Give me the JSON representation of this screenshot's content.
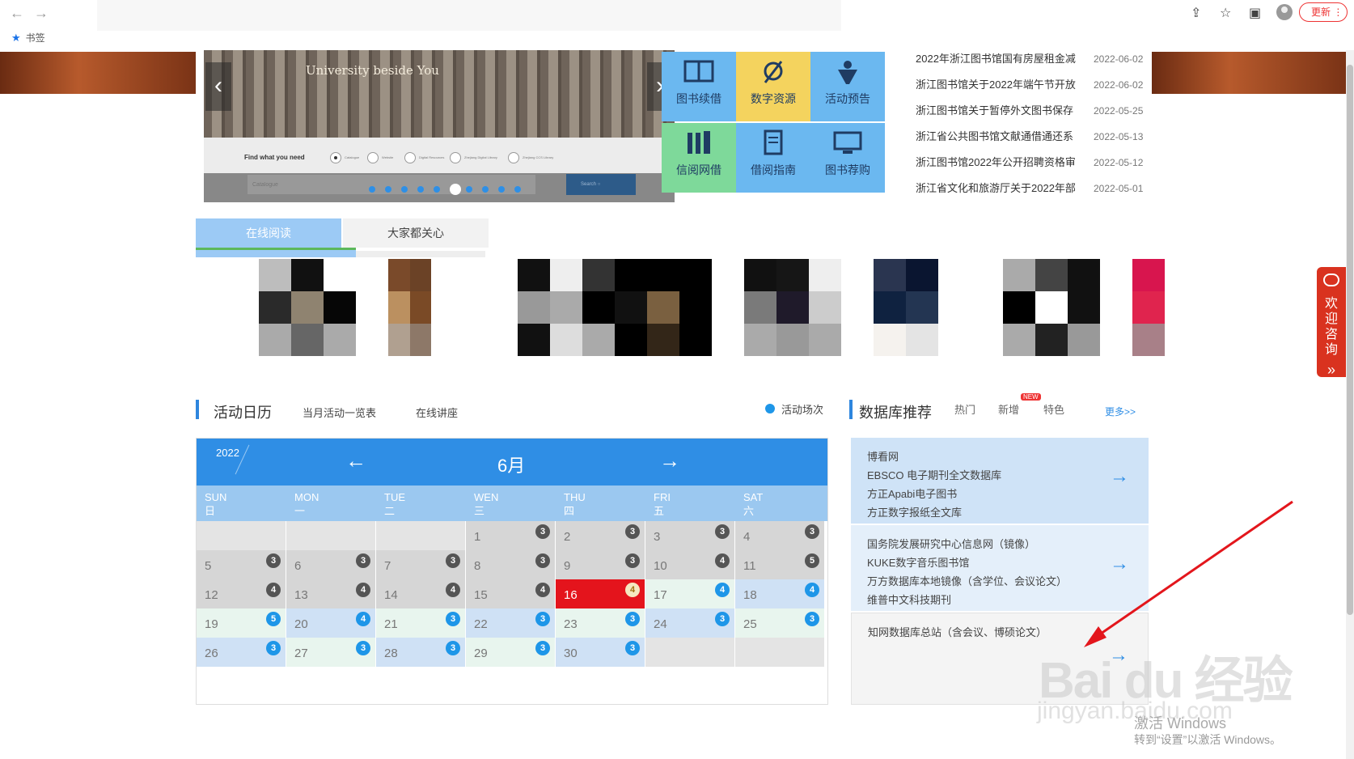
{
  "browser": {
    "back": "←",
    "forward": "→",
    "bookmark_label": "书签",
    "update_label": "更新",
    "update_more": "⋮"
  },
  "carousel": {
    "caption": "University beside You",
    "find_label": "Find what you need",
    "options": [
      "Catalogue",
      "Website",
      "Digital Resources",
      "Zhejiang Digital Library",
      "Zhejiang CCS Library"
    ],
    "search_placeholder": "Catalogue",
    "search_button": "Search",
    "dot_count": 10,
    "active_dot": 5
  },
  "tiles": [
    {
      "label": "图书续借",
      "icon": "book-open-icon",
      "color": "#6bb8f0"
    },
    {
      "label": "数字资源",
      "icon": "satellite-icon",
      "color": "#f4d35e"
    },
    {
      "label": "活动预告",
      "icon": "person-icon",
      "color": "#6bb8f0"
    },
    {
      "label": "信阅网借",
      "icon": "bookshelf-icon",
      "color": "#7ed99a"
    },
    {
      "label": "借阅指南",
      "icon": "guide-icon",
      "color": "#6bb8f0"
    },
    {
      "label": "图书荐购",
      "icon": "computer-icon",
      "color": "#6bb8f0"
    }
  ],
  "news": [
    {
      "title": "2022年浙江图书馆国有房屋租金减",
      "date": "2022-06-02"
    },
    {
      "title": "浙江图书馆关于2022年端午节开放",
      "date": "2022-06-02"
    },
    {
      "title": "浙江图书馆关于暂停外文图书保存",
      "date": "2022-05-25"
    },
    {
      "title": "浙江省公共图书馆文献通借通还系",
      "date": "2022-05-13"
    },
    {
      "title": "浙江图书馆2022年公开招聘资格审",
      "date": "2022-05-12"
    },
    {
      "title": "浙江省文化和旅游厅关于2022年部",
      "date": "2022-05-01"
    }
  ],
  "reading_tabs": [
    "在线阅读",
    "大家都关心"
  ],
  "activity": {
    "title": "活动日历",
    "links": [
      "当月活动一览表",
      "在线讲座"
    ],
    "legend": "活动场次"
  },
  "database": {
    "title": "数据库推荐",
    "tabs": [
      "热门",
      "新增",
      "特色"
    ],
    "new_badge": "NEW",
    "more": "更多>>",
    "groups": [
      [
        "博看网",
        "EBSCO 电子期刊全文数据库",
        "方正Apabi电子图书",
        "方正数字报纸全文库"
      ],
      [
        "国务院发展研究中心信息网（镜像）",
        "KUKE数字音乐图书馆",
        "万方数据库本地镜像（含学位、会议论文）",
        "维普中文科技期刊"
      ],
      [
        "知网数据库总站（含会议、博硕论文）"
      ]
    ],
    "go_arrow": "→"
  },
  "calendar": {
    "year": "2022",
    "month": "6月",
    "prev": "←",
    "next": "→",
    "days": [
      {
        "en": "SUN",
        "zh": "日"
      },
      {
        "en": "MON",
        "zh": "一"
      },
      {
        "en": "TUE",
        "zh": "二"
      },
      {
        "en": "WEN",
        "zh": "三"
      },
      {
        "en": "THU",
        "zh": "四"
      },
      {
        "en": "FRI",
        "zh": "五"
      },
      {
        "en": "SAT",
        "zh": "六"
      }
    ],
    "colors": {
      "past": "#d6d6d6",
      "today": "#e4141c",
      "future_a": "#cfe1f5",
      "future_b": "#e8f5ee",
      "badge_past": "#555555",
      "badge_future": "#1e96e8"
    },
    "rows": [
      [
        null,
        null,
        null,
        {
          "d": "1",
          "n": "3",
          "s": "past"
        },
        {
          "d": "2",
          "n": "3",
          "s": "past"
        },
        {
          "d": "3",
          "n": "3",
          "s": "past"
        },
        {
          "d": "4",
          "n": "3",
          "s": "past"
        }
      ],
      [
        {
          "d": "5",
          "n": "3",
          "s": "past"
        },
        {
          "d": "6",
          "n": "3",
          "s": "past"
        },
        {
          "d": "7",
          "n": "3",
          "s": "past"
        },
        {
          "d": "8",
          "n": "3",
          "s": "past"
        },
        {
          "d": "9",
          "n": "3",
          "s": "past"
        },
        {
          "d": "10",
          "n": "4",
          "s": "past"
        },
        {
          "d": "11",
          "n": "5",
          "s": "past"
        }
      ],
      [
        {
          "d": "12",
          "n": "4",
          "s": "past"
        },
        {
          "d": "13",
          "n": "4",
          "s": "past"
        },
        {
          "d": "14",
          "n": "4",
          "s": "past"
        },
        {
          "d": "15",
          "n": "4",
          "s": "past"
        },
        {
          "d": "16",
          "n": "4",
          "s": "today"
        },
        {
          "d": "17",
          "n": "4",
          "s": "b"
        },
        {
          "d": "18",
          "n": "4",
          "s": "a"
        }
      ],
      [
        {
          "d": "19",
          "n": "5",
          "s": "b"
        },
        {
          "d": "20",
          "n": "4",
          "s": "a"
        },
        {
          "d": "21",
          "n": "3",
          "s": "b"
        },
        {
          "d": "22",
          "n": "3",
          "s": "a"
        },
        {
          "d": "23",
          "n": "3",
          "s": "b"
        },
        {
          "d": "24",
          "n": "3",
          "s": "a"
        },
        {
          "d": "25",
          "n": "3",
          "s": "b"
        }
      ],
      [
        {
          "d": "26",
          "n": "3",
          "s": "a"
        },
        {
          "d": "27",
          "n": "3",
          "s": "b"
        },
        {
          "d": "28",
          "n": "3",
          "s": "a"
        },
        {
          "d": "29",
          "n": "3",
          "s": "b"
        },
        {
          "d": "30",
          "n": "3",
          "s": "a"
        },
        null,
        null
      ]
    ]
  },
  "consult": "欢迎咨询",
  "consult_more": "»",
  "watermark": {
    "title": "激活 Windows",
    "subtitle": "转到“设置”以激活 Windows。",
    "logo": "Bai du 经验",
    "site": "jingyan.baidu.com"
  }
}
